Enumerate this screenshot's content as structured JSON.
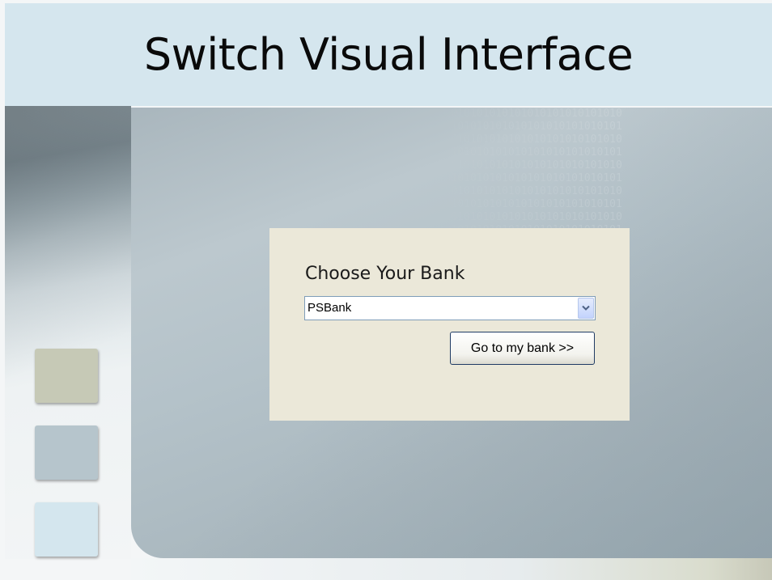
{
  "slide": {
    "title": "Switch Visual Interface"
  },
  "bank_chooser": {
    "heading": "Choose Your Bank",
    "selected_bank": "PSBank",
    "go_button_label": "Go to my bank >>"
  },
  "colors": {
    "title_band": "#d5e6ee",
    "bank_box": "#ebe8d9",
    "square_1": "#c6c9b6",
    "square_2": "#b6c5cc",
    "square_3": "#d4e6ee"
  },
  "icons": {
    "dropdown": "chevron-down-icon"
  }
}
